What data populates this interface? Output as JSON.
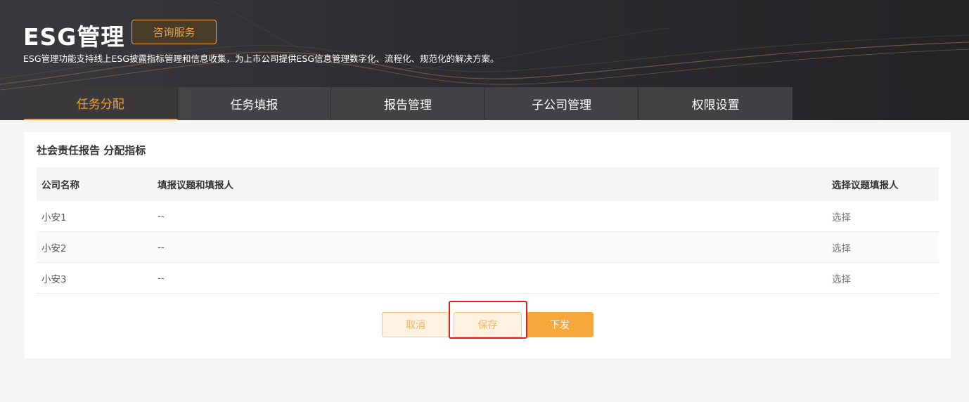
{
  "header": {
    "title": "ESG管理",
    "consult_label": "咨询服务",
    "subtitle": "ESG管理功能支持线上ESG披露指标管理和信息收集，为上市公司提供ESG信息管理数字化、流程化、规范化的解决方案。"
  },
  "tabs": [
    {
      "label": "任务分配",
      "active": true
    },
    {
      "label": "任务填报",
      "active": false
    },
    {
      "label": "报告管理",
      "active": false
    },
    {
      "label": "子公司管理",
      "active": false
    },
    {
      "label": "权限设置",
      "active": false
    }
  ],
  "card": {
    "title": "社会责任报告 分配指标",
    "columns": [
      "公司名称",
      "填报议题和填报人",
      "选择议题填报人"
    ],
    "rows": [
      {
        "company": "小安1",
        "topics": "--",
        "action": "选择"
      },
      {
        "company": "小安2",
        "topics": "--",
        "action": "选择"
      },
      {
        "company": "小安3",
        "topics": "--",
        "action": "选择"
      }
    ],
    "buttons": {
      "cancel": "取消",
      "save": "保存",
      "send": "下发"
    }
  },
  "colors": {
    "accent": "#f0a23a",
    "header_bg": "#2a2a2e",
    "highlight": "#e02020"
  }
}
